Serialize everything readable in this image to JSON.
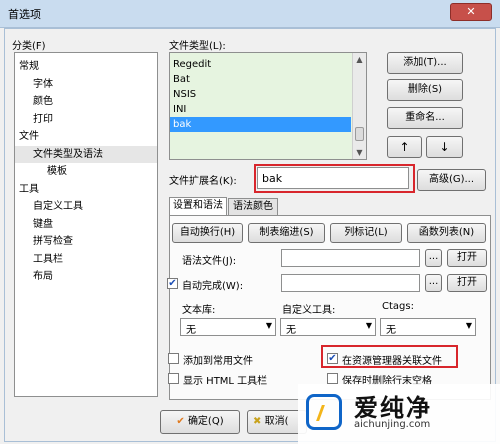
{
  "window": {
    "title": "首选项",
    "close_label": "✕"
  },
  "sidebar": {
    "label": "分类(F)",
    "items": [
      {
        "label": "常规",
        "level": 0
      },
      {
        "label": "字体",
        "level": 1
      },
      {
        "label": "颜色",
        "level": 1
      },
      {
        "label": "打印",
        "level": 1
      },
      {
        "label": "文件",
        "level": 0
      },
      {
        "label": "文件类型及语法",
        "level": 1,
        "selected": true
      },
      {
        "label": "模板",
        "level": 1
      },
      {
        "label": "工具",
        "level": 0
      },
      {
        "label": "自定义工具",
        "level": 1
      },
      {
        "label": "键盘",
        "level": 1
      },
      {
        "label": "拼写检查",
        "level": 1
      },
      {
        "label": "工具栏",
        "level": 1
      },
      {
        "label": "布局",
        "level": 1
      }
    ]
  },
  "filetypes": {
    "label": "文件类型(L):",
    "items": [
      "Regedit",
      "Bat",
      "NSIS",
      "INI",
      "bak"
    ],
    "selected": "bak"
  },
  "right_buttons": {
    "add": "添加(T)...",
    "delete": "删除(S)",
    "rename": "重命名...",
    "up": "↑",
    "down": "↓"
  },
  "extension": {
    "label": "文件扩展名(K):",
    "value": "bak",
    "advanced": "高级(G)..."
  },
  "tabs": {
    "settings": "设置和语法",
    "colors": "语法颜色"
  },
  "panel": {
    "auto_wrap": "自动换行(H)",
    "tab_indent": "制表缩进(S)",
    "column_mark": "列标记(L)",
    "function_list": "函数列表(N)",
    "syntax_file_label": "语法文件(J):",
    "syntax_file_value": "",
    "autocomplete_label": "自动完成(W):",
    "autocomplete_checked": true,
    "autocomplete_value": "",
    "browse": "...",
    "open": "打开",
    "text_lib_label": "文本库:",
    "custom_tool_label": "自定义工具:",
    "ctags_label": "Ctags:",
    "text_lib_value": "无",
    "custom_tool_value": "无",
    "ctags_value": "无",
    "add_common": "添加到常用文件",
    "assoc_explorer": "在资源管理器关联文件",
    "show_html_toolbar": "显示 HTML 工具栏",
    "trim_trailing": "保存时删除行末空格",
    "add_common_checked": false,
    "assoc_explorer_checked": true,
    "show_html_checked": false,
    "trim_checked": false
  },
  "footer": {
    "ok": "确定(Q)",
    "cancel": "取消("
  },
  "watermark": {
    "brand": "爱纯净",
    "url": "aichunjing.com"
  }
}
